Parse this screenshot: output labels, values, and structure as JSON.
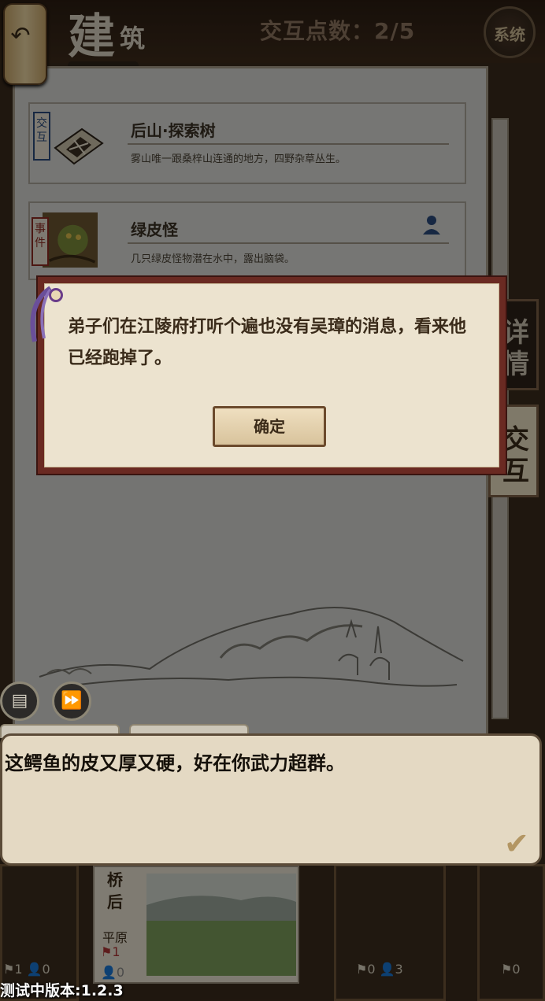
{
  "header": {
    "title_main": "建",
    "title_sub": "筑",
    "interaction_points": "交互点数：2/5",
    "system_button": "系统"
  },
  "cards": [
    {
      "tag": "交互",
      "title": "后山·探索树",
      "desc": "雾山唯一跟桑梓山连通的地方，四野杂草丛生。"
    },
    {
      "tag": "事件",
      "title": "绿皮怪",
      "desc": "几只绿皮怪物潜在水中，露出脑袋。"
    }
  ],
  "side_tabs": [
    "详情",
    "交互"
  ],
  "dialog": {
    "message": "弟子们在江陵府打听个遍也没有吴璋的消息，看来他已经跑掉了。",
    "confirm": "确定"
  },
  "talk": {
    "text": "这鳄鱼的皮又厚又硬，好在你武力超群。"
  },
  "bottom_cards": [
    {
      "flag": "1",
      "people": "0"
    },
    {
      "label": "桥后",
      "terrain": "平原",
      "flag": "1",
      "people": "0"
    },
    {
      "flag": "0",
      "people": "3"
    },
    {
      "flag": "0"
    }
  ],
  "version": "测试中版本:1.2.3",
  "colors": {
    "dialog_border": "#6a2a22",
    "dialog_bg": "#ece3cf",
    "panel": "#d3d4d0",
    "accent_purple": "#6a3d8a"
  },
  "icons": [
    "back-arrow-icon",
    "system-icon",
    "person-icon",
    "log-icon",
    "fast-forward-icon",
    "check-icon",
    "flag-icon"
  ]
}
